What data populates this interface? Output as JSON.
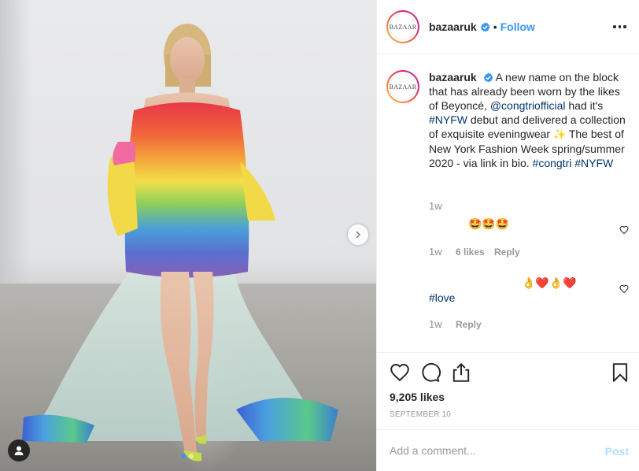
{
  "post": {
    "username": "bazaaruk",
    "avatar_text": "BAZAAR",
    "follow_label": "Follow",
    "separator": "•",
    "caption": {
      "username": "bazaaruk",
      "text_1": "A new name on the block that has already been worn by the likes of Beyoncé, ",
      "mention": "@congtriofficial",
      "text_2": " had it's ",
      "hashtag_1": "#NYFW",
      "text_3": " debut and delivered a collection of exquisite eveningwear ",
      "sparkle_emoji": "✨",
      "text_4": " The best of New York Fashion Week spring/summer 2020 - via link in bio. ",
      "hashtag_2": "#congtri",
      "hashtag_3": "#NYFW",
      "time": "1w"
    },
    "comments": [
      {
        "text": "🤩🤩🤩",
        "time": "1w",
        "likes": "6 likes",
        "reply": "Reply"
      },
      {
        "text": "👌❤️👌❤️",
        "hashtag": "#love",
        "time": "1w",
        "reply": "Reply"
      }
    ],
    "likes": "9,205 likes",
    "date": "SEPTEMBER 10",
    "add_comment_placeholder": "Add a comment...",
    "post_button": "Post",
    "carousel": {
      "total": 2,
      "current": 1
    }
  },
  "colors": {
    "accent": "#3897f0",
    "text": "#262626",
    "muted": "#999999",
    "link": "#003569"
  },
  "icons": [
    "verified-badge-icon",
    "more-options-icon",
    "heart-icon",
    "comment-icon",
    "share-icon",
    "bookmark-icon",
    "carousel-next-icon",
    "user-tag-icon"
  ]
}
